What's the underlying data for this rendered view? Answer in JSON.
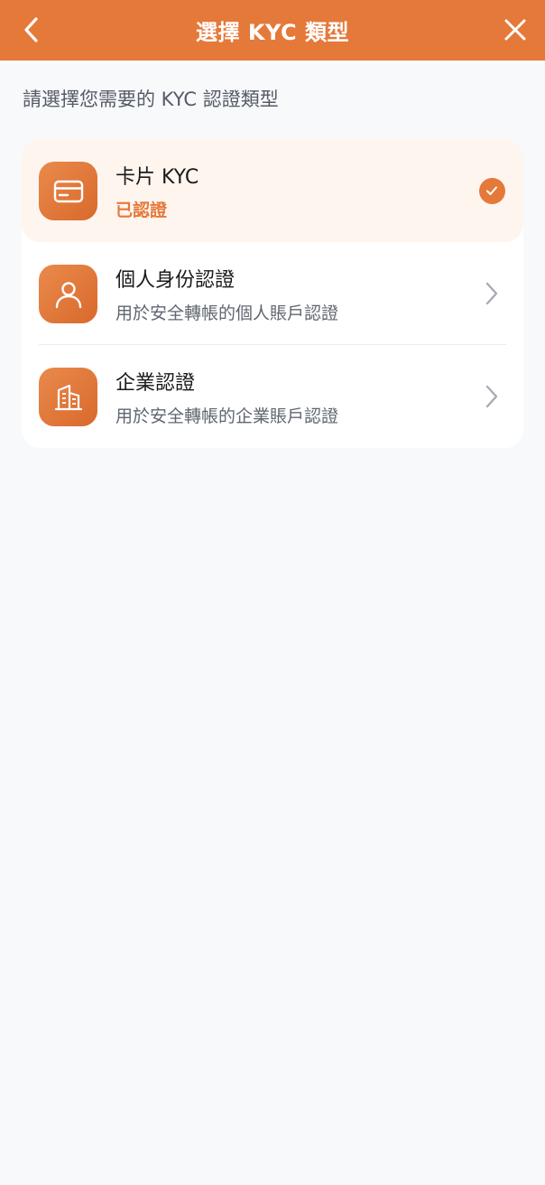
{
  "header": {
    "title": "選擇 KYC 類型",
    "back_icon": "chevron-left-icon",
    "close_icon": "close-icon",
    "background_color": "#e5793a"
  },
  "subtitle": "請選擇您需要的 KYC 認證類型",
  "options": [
    {
      "label": "卡片 KYC",
      "description": "已認證",
      "icon": "card-icon",
      "trailing_icon": "check-circle-icon",
      "selected": true
    },
    {
      "label": "個人身份認證",
      "description": "用於安全轉帳的個人賬戶認證",
      "icon": "person-icon",
      "trailing_icon": "chevron-right-icon",
      "selected": false
    },
    {
      "label": "企業認證",
      "description": "用於安全轉帳的企業賬戶認證",
      "icon": "building-icon",
      "trailing_icon": "chevron-right-icon",
      "selected": false
    }
  ],
  "colors": {
    "accent": "#e5793a",
    "selected_bg": "#fef5ef",
    "page_bg": "#f8f9fb"
  }
}
